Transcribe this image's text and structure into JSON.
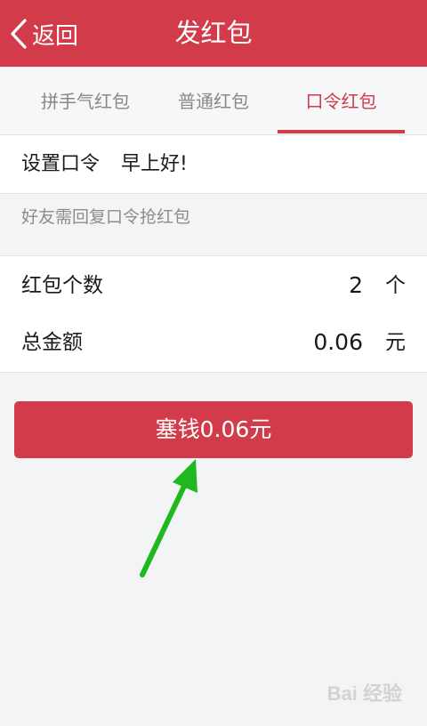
{
  "header": {
    "back_label": "返回",
    "title": "发红包"
  },
  "tabs": [
    {
      "label": "拼手气红包",
      "active": false
    },
    {
      "label": "普通红包",
      "active": false
    },
    {
      "label": "口令红包",
      "active": true
    }
  ],
  "password": {
    "label": "设置口令",
    "value": "早上好!"
  },
  "hint": "好友需回复口令抢红包",
  "count": {
    "label": "红包个数",
    "value": "2",
    "unit": "个"
  },
  "amount": {
    "label": "总金额",
    "value": "0.06",
    "unit": "元"
  },
  "send_button": "塞钱0.06元",
  "watermark": "Bai 经验",
  "colors": {
    "accent": "#d23b49",
    "annotation_arrow": "#1fb81f"
  },
  "icons": {
    "back": "chevron-left-icon",
    "annotation": "arrow-icon"
  }
}
